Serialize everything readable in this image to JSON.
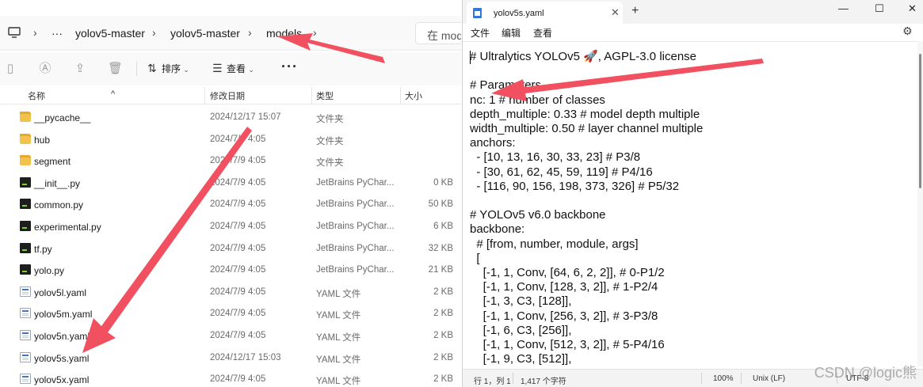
{
  "explorer": {
    "breadcrumb": [
      "···",
      "yolov5-master",
      "yolov5-master",
      "models"
    ],
    "search_placeholder": "在 mod",
    "toolbar": {
      "sort": "排序",
      "view": "查看",
      "more": "···"
    },
    "columns": {
      "name": "名称",
      "date": "修改日期",
      "type": "类型",
      "size": "大小"
    },
    "files": [
      {
        "name": "__pycache__",
        "date": "2024/12/17 15:07",
        "type": "文件夹",
        "size": "",
        "icon": "folder-icon"
      },
      {
        "name": "hub",
        "date": "2024/7/9 4:05",
        "type": "文件夹",
        "size": "",
        "icon": "folder-icon"
      },
      {
        "name": "segment",
        "date": "2024/7/9 4:05",
        "type": "文件夹",
        "size": "",
        "icon": "folder-icon"
      },
      {
        "name": "__init__.py",
        "date": "2024/7/9 4:05",
        "type": "JetBrains PyChar...",
        "size": "0 KB",
        "icon": "pycharm-file-icon"
      },
      {
        "name": "common.py",
        "date": "2024/7/9 4:05",
        "type": "JetBrains PyChar...",
        "size": "50 KB",
        "icon": "pycharm-file-icon"
      },
      {
        "name": "experimental.py",
        "date": "2024/7/9 4:05",
        "type": "JetBrains PyChar...",
        "size": "6 KB",
        "icon": "pycharm-file-icon"
      },
      {
        "name": "tf.py",
        "date": "2024/7/9 4:05",
        "type": "JetBrains PyChar...",
        "size": "32 KB",
        "icon": "pycharm-file-icon"
      },
      {
        "name": "yolo.py",
        "date": "2024/7/9 4:05",
        "type": "JetBrains PyChar...",
        "size": "21 KB",
        "icon": "pycharm-file-icon"
      },
      {
        "name": "yolov5l.yaml",
        "date": "2024/7/9 4:05",
        "type": "YAML 文件",
        "size": "2 KB",
        "icon": "yaml-file-icon"
      },
      {
        "name": "yolov5m.yaml",
        "date": "2024/7/9 4:05",
        "type": "YAML 文件",
        "size": "2 KB",
        "icon": "yaml-file-icon"
      },
      {
        "name": "yolov5n.yaml",
        "date": "2024/7/9 4:05",
        "type": "YAML 文件",
        "size": "2 KB",
        "icon": "yaml-file-icon"
      },
      {
        "name": "yolov5s.yaml",
        "date": "2024/12/17 15:03",
        "type": "YAML 文件",
        "size": "2 KB",
        "icon": "yaml-file-icon"
      },
      {
        "name": "yolov5x.yaml",
        "date": "2024/7/9 4:05",
        "type": "YAML 文件",
        "size": "2 KB",
        "icon": "yaml-file-icon"
      }
    ]
  },
  "notepad": {
    "tab_title": "yolov5s.yaml",
    "menu": [
      "文件",
      "编辑",
      "查看"
    ],
    "lines": [
      "# Ultralytics YOLOv5 🚀, AGPL-3.0 license",
      "",
      "# Parameters",
      "nc: 1 # number of classes",
      "depth_multiple: 0.33 # model depth multiple",
      "width_multiple: 0.50 # layer channel multiple",
      "anchors:",
      "  - [10, 13, 16, 30, 33, 23] # P3/8",
      "  - [30, 61, 62, 45, 59, 119] # P4/16",
      "  - [116, 90, 156, 198, 373, 326] # P5/32",
      "",
      "# YOLOv5 v6.0 backbone",
      "backbone:",
      "  # [from, number, module, args]",
      "  [",
      "    [-1, 1, Conv, [64, 6, 2, 2]], # 0-P1/2",
      "    [-1, 1, Conv, [128, 3, 2]], # 1-P2/4",
      "    [-1, 3, C3, [128]],",
      "    [-1, 1, Conv, [256, 3, 2]], # 3-P3/8",
      "    [-1, 6, C3, [256]],",
      "    [-1, 1, Conv, [512, 3, 2]], # 5-P4/16",
      "    [-1, 9, C3, [512]],"
    ],
    "status": {
      "position": "行 1，列 1",
      "chars": "1,417 个字符",
      "zoom": "100%",
      "line_ending": "Unix (LF)",
      "encoding": "UTF-8"
    }
  },
  "watermark": "CSDN @logic熊",
  "colors": {
    "arrow": "#f0505f",
    "folder": "#f2c14e",
    "accent": "#2f7ad9"
  }
}
